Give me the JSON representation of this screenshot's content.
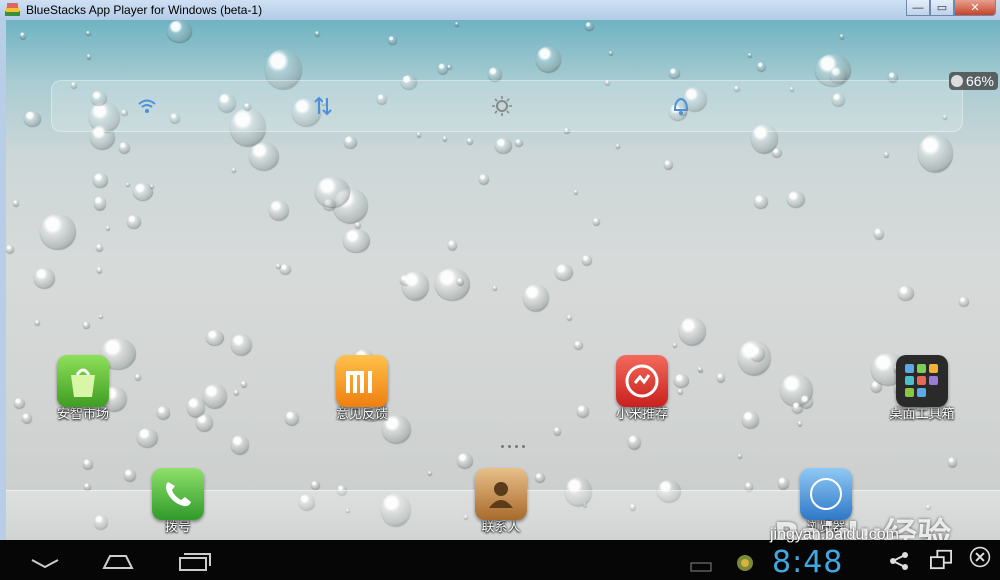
{
  "window": {
    "title": "BlueStacks App Player for Windows (beta-1)",
    "controls": {
      "minimize": "—",
      "maximize": "▭",
      "close": "✕"
    }
  },
  "status": {
    "battery": "66%",
    "quick_settings": [
      "wifi-icon",
      "data-sync-icon",
      "brightness-icon",
      "sound-icon"
    ]
  },
  "home": {
    "apps": [
      {
        "label": "安智市场",
        "icon": "anzhi-market-icon",
        "color": "#5cc234"
      },
      {
        "label": "意见反馈",
        "icon": "feedback-mi-icon",
        "color": "#f49a1e"
      },
      {
        "label": "小米推荐",
        "icon": "mi-recommend-icon",
        "color": "#d9332e"
      },
      {
        "label": "桌面工具箱",
        "icon": "desktop-toolbox-icon",
        "color": "#222222"
      }
    ],
    "dock": [
      {
        "label": "拨号",
        "icon": "phone-icon",
        "color": "#3fae3a"
      },
      {
        "label": "联系人",
        "icon": "contacts-icon",
        "color": "#b07a3c"
      },
      {
        "label": "浏览器",
        "icon": "browser-icon",
        "color": "#3c8fd9"
      }
    ]
  },
  "system_bar": {
    "clock": "8:48",
    "buttons": [
      "back-icon",
      "home-icon",
      "recent-apps-icon"
    ]
  },
  "watermark": {
    "brand": "Baidu经验",
    "url": "jingyan.baidu.com"
  }
}
